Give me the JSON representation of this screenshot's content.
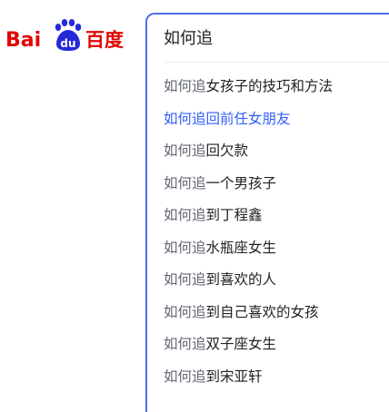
{
  "logo": {
    "text_left": "Bai",
    "paw_text": "du",
    "text_right": "百度",
    "colors": {
      "red": "#e10602",
      "blue": "#2529d8"
    }
  },
  "search": {
    "value": "如何追",
    "placeholder": ""
  },
  "suggestions": [
    {
      "prefix": "如何追",
      "rest": "女孩子的技巧和方法"
    },
    {
      "prefix": "如何追",
      "rest": "回前任女朋友",
      "highlighted": true
    },
    {
      "prefix": "如何追",
      "rest": "回欠款"
    },
    {
      "prefix": "如何追",
      "rest": "一个男孩子"
    },
    {
      "prefix": "如何追",
      "rest": "到丁程鑫"
    },
    {
      "prefix": "如何追",
      "rest": "水瓶座女生"
    },
    {
      "prefix": "如何追",
      "rest": "到喜欢的人"
    },
    {
      "prefix": "如何追",
      "rest": "到自己喜欢的女孩"
    },
    {
      "prefix": "如何追",
      "rest": "双子座女生"
    },
    {
      "prefix": "如何追",
      "rest": "到宋亚轩"
    }
  ],
  "colors": {
    "accent_border": "#4e6ef2",
    "highlight_text": "#315efb",
    "prefix_text": "#626675",
    "body_text": "#222222"
  }
}
